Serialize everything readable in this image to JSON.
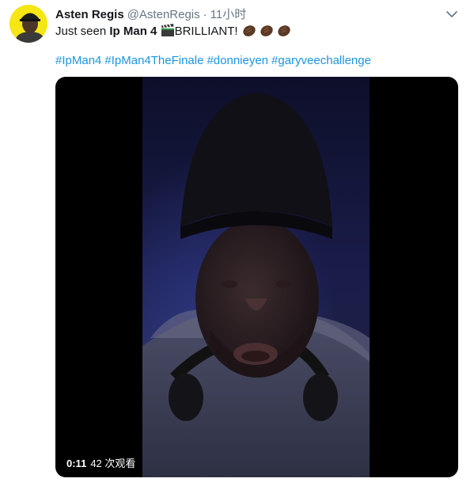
{
  "tweet": {
    "author": {
      "display_name": "Asten Regis",
      "screen_name": "@AstenRegis",
      "avatar_icon": "person-avatar"
    },
    "separator": "·",
    "time": "11小时",
    "text": {
      "prefix": "Just seen ",
      "bold": "Ip Man 4",
      "emoji_clapper": "clapper-board-icon",
      "after_clapper": "BRILLIANT!",
      "emoji_clap": "clapping-hands-icon"
    },
    "hashtags": [
      "#IpMan4",
      "#IpMan4TheFinale",
      "#donnieyen",
      "#garyveechallenge"
    ],
    "video": {
      "duration": "0:11",
      "views": "42 次观看"
    }
  },
  "colors": {
    "link": "#1b95e0",
    "secondary_text": "#657786",
    "primary_text": "#14171a",
    "avatar_bg": "#f5e614"
  }
}
